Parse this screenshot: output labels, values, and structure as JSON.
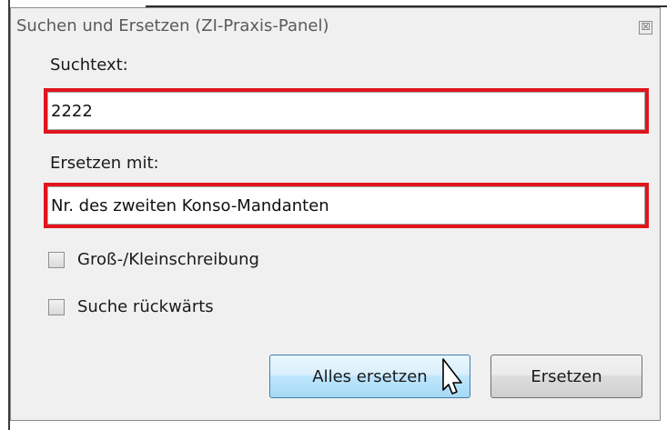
{
  "window": {
    "title": "Suchen und Ersetzen (ZI-Praxis-Panel)",
    "close_glyph": "☒"
  },
  "search": {
    "label": "Suchtext:",
    "value": "2222"
  },
  "replace": {
    "label": "Ersetzen mit:",
    "value": "Nr. des zweiten Konso-Mandanten"
  },
  "options": [
    {
      "label": "Groß-/Kleinschreibung",
      "checked": false
    },
    {
      "label": "Suche rückwärts",
      "checked": false
    }
  ],
  "buttons": {
    "replace_all": "Alles ersetzen",
    "replace": "Ersetzen"
  },
  "colors": {
    "highlight": "#e0151c",
    "primary_button": "#bee6fd"
  }
}
